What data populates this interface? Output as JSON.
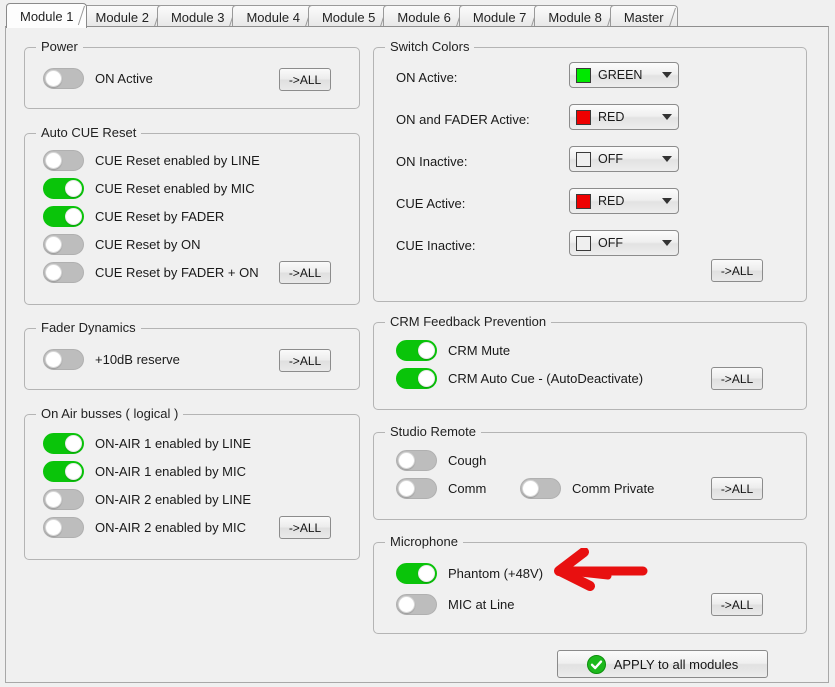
{
  "tabs": [
    {
      "label": "Module 1",
      "active": true
    },
    {
      "label": "Module 2",
      "active": false
    },
    {
      "label": "Module 3",
      "active": false
    },
    {
      "label": "Module 4",
      "active": false
    },
    {
      "label": "Module 5",
      "active": false
    },
    {
      "label": "Module 6",
      "active": false
    },
    {
      "label": "Module 7",
      "active": false
    },
    {
      "label": "Module 8",
      "active": false
    },
    {
      "label": "Master",
      "active": false
    }
  ],
  "all_button_label": "->ALL",
  "groups": {
    "power": {
      "title": "Power",
      "rows": [
        {
          "label": "ON Active",
          "on": false
        }
      ]
    },
    "auto_cue_reset": {
      "title": "Auto CUE Reset",
      "rows": [
        {
          "label": "CUE Reset enabled by LINE",
          "on": false
        },
        {
          "label": "CUE Reset enabled by MIC",
          "on": true
        },
        {
          "label": "CUE Reset by FADER",
          "on": true
        },
        {
          "label": "CUE Reset by ON",
          "on": false
        },
        {
          "label": "CUE Reset by FADER  + ON",
          "on": false
        }
      ]
    },
    "fader_dynamics": {
      "title": "Fader Dynamics",
      "rows": [
        {
          "label": "+10dB reserve",
          "on": false
        }
      ]
    },
    "on_air_busses": {
      "title": "On Air busses ( logical )",
      "rows": [
        {
          "label": "ON-AIR 1 enabled by LINE",
          "on": true
        },
        {
          "label": "ON-AIR 1 enabled by MIC",
          "on": true
        },
        {
          "label": "ON-AIR 2 enabled by LINE",
          "on": false
        },
        {
          "label": "ON-AIR 2 enabled by MIC",
          "on": false
        }
      ]
    },
    "switch_colors": {
      "title": "Switch Colors",
      "rows": [
        {
          "label": "ON Active:",
          "value": "GREEN",
          "color": "#00e800"
        },
        {
          "label": "ON and FADER Active:",
          "value": "RED",
          "color": "#ee0000"
        },
        {
          "label": "ON Inactive:",
          "value": "OFF",
          "color": "#efefef"
        },
        {
          "label": "CUE Active:",
          "value": "RED",
          "color": "#ee0000"
        },
        {
          "label": "CUE Inactive:",
          "value": "OFF",
          "color": "#efefef"
        }
      ]
    },
    "crm_feedback": {
      "title": "CRM Feedback Prevention",
      "rows": [
        {
          "label": "CRM Mute",
          "on": true
        },
        {
          "label": "CRM Auto Cue - (AutoDeactivate)",
          "on": true
        }
      ]
    },
    "studio_remote": {
      "title": "Studio Remote",
      "rows": [
        {
          "label": "Cough",
          "on": false
        },
        {
          "label": "Comm",
          "on": false
        },
        {
          "label": "Comm Private",
          "on": false
        }
      ]
    },
    "microphone": {
      "title": "Microphone",
      "rows": [
        {
          "label": "Phantom (+48V)",
          "on": true
        },
        {
          "label": "MIC at Line",
          "on": false
        }
      ]
    }
  },
  "apply": {
    "label": "APPLY to all modules",
    "icon": "check-circle-icon",
    "icon_color": "#1db91d"
  },
  "annotation": {
    "type": "arrow",
    "color": "#e81010",
    "points_to": "Phantom (+48V)"
  }
}
